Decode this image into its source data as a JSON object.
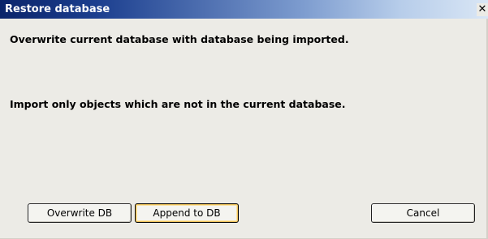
{
  "window": {
    "title": "Restore database",
    "close_glyph": "✕"
  },
  "messages": {
    "overwrite_text": "Overwrite current database with database being imported.",
    "append_text": "Import only objects which are not in the current database."
  },
  "buttons": {
    "overwrite_label": "Overwrite DB",
    "append_label": "Append to DB",
    "cancel_label": "Cancel"
  },
  "colors": {
    "titlebar_start": "#0a246a",
    "titlebar_end": "#d9e6f5",
    "dialog_background": "#ecebe6",
    "focus_highlight": "#f0c35a"
  }
}
